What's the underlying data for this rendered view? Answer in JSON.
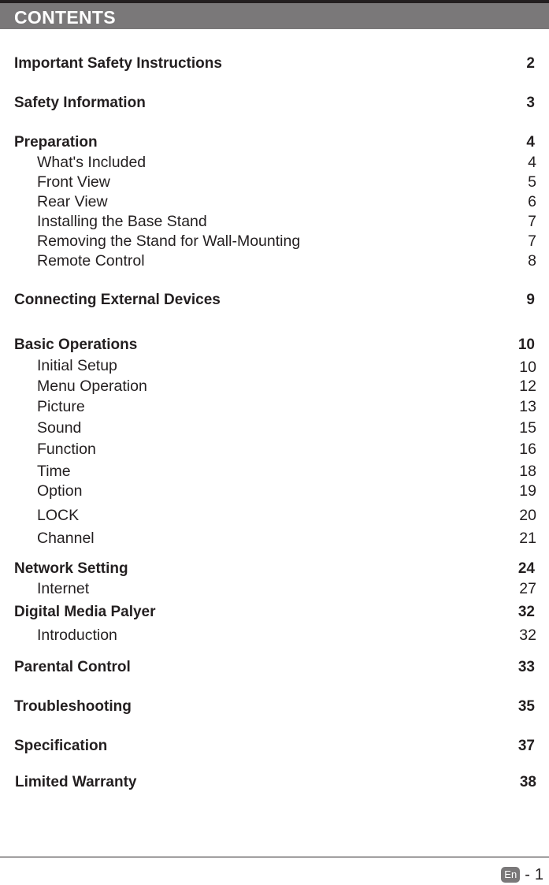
{
  "header": {
    "title": "CONTENTS"
  },
  "toc": [
    {
      "type": "section",
      "label": "Important Safety Instructions",
      "page": "2"
    },
    {
      "type": "section",
      "label": "Safety Information",
      "page": "3"
    },
    {
      "type": "section",
      "label": "Preparation",
      "page": "4"
    },
    {
      "type": "sub",
      "label": "What's Included",
      "page": "4"
    },
    {
      "type": "sub",
      "label": "Front View",
      "page": "5"
    },
    {
      "type": "sub",
      "label": "Rear View",
      "page": "6"
    },
    {
      "type": "sub",
      "label": "Installing the Base Stand",
      "page": "7"
    },
    {
      "type": "sub",
      "label": "Removing the Stand for Wall-Mounting",
      "page": "7"
    },
    {
      "type": "sub",
      "label": "Remote Control",
      "page": "8"
    },
    {
      "type": "section",
      "label": "Connecting External Devices",
      "page": "9"
    },
    {
      "type": "section",
      "label": "Basic Operations",
      "page": "10"
    },
    {
      "type": "sub",
      "label": "Initial Setup",
      "page": "10"
    },
    {
      "type": "sub",
      "label": "Menu Operation",
      "page": "12"
    },
    {
      "type": "sub",
      "label": "Picture",
      "page": "13"
    },
    {
      "type": "sub",
      "label": "Sound",
      "page": "15"
    },
    {
      "type": "sub",
      "label": "Function",
      "page": "16"
    },
    {
      "type": "sub",
      "label": "Time",
      "page": "18"
    },
    {
      "type": "sub",
      "label": "Option",
      "page": "19"
    },
    {
      "type": "sub",
      "label": "LOCK",
      "page": "20"
    },
    {
      "type": "sub",
      "label": "Channel",
      "page": "21"
    },
    {
      "type": "section",
      "label": "Network Setting",
      "page": "24"
    },
    {
      "type": "sub",
      "label": "Internet",
      "page": "27"
    },
    {
      "type": "section",
      "label": "Digital Media Palyer",
      "page": "32"
    },
    {
      "type": "sub",
      "label": "Introduction",
      "page": "32"
    },
    {
      "type": "section",
      "label": "Parental Control",
      "page": "33"
    },
    {
      "type": "section",
      "label": "Troubleshooting",
      "page": "35"
    },
    {
      "type": "section",
      "label": "Specification",
      "page": "37"
    },
    {
      "type": "section",
      "label": "Limited Warranty",
      "page": "38"
    }
  ],
  "footer": {
    "language": "En",
    "page_separator": "-",
    "page_number": "1"
  }
}
